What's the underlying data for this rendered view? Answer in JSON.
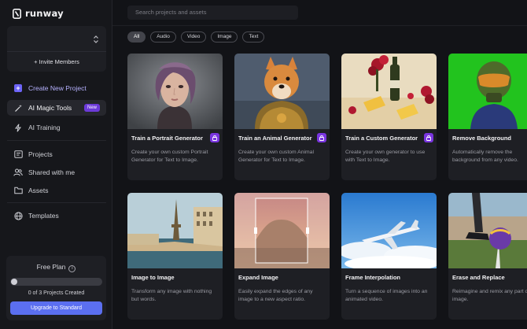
{
  "brand": {
    "name": "runway"
  },
  "workspace": {
    "invite_label": "+ Invite Members"
  },
  "nav": {
    "create_project": "Create New Project",
    "ai_magic_tools": "AI Magic Tools",
    "new_badge": "New",
    "ai_training": "AI Training",
    "projects": "Projects",
    "shared": "Shared with me",
    "assets": "Assets",
    "templates": "Templates"
  },
  "plan": {
    "title": "Free Plan",
    "info_icon": "i",
    "usage_text": "0 of 3 Projects Created",
    "usage_fraction": 0,
    "upgrade_label": "Upgrade to Standard"
  },
  "search": {
    "placeholder": "Search projects and assets"
  },
  "filters": [
    "All",
    "Audio",
    "Video",
    "Image",
    "Text"
  ],
  "active_filter": "All",
  "colors": {
    "accent": "#6c63f6",
    "badge_purple": "#7a35e0",
    "upgrade_blue": "#5b6ff0"
  },
  "cards": [
    {
      "title": "Train a Portrait Generator",
      "desc": "Create your own custom Portrait Generator for Text to Image.",
      "locked": true
    },
    {
      "title": "Train an Animal Generator",
      "desc": "Create your own custom Animal Generator for Text to Image.",
      "locked": true
    },
    {
      "title": "Train a Custom Generator",
      "desc": "Create your own generator to use with Text to Image.",
      "locked": true
    },
    {
      "title": "Remove Background",
      "desc": "Automatically remove the background from any video.",
      "locked": false
    },
    {
      "title": "Image to Image",
      "desc": "Transform any image with nothing but words.",
      "locked": false
    },
    {
      "title": "Expand Image",
      "desc": "Easily expand the edges of any image to a new aspect ratio.",
      "locked": false
    },
    {
      "title": "Frame Interpolation",
      "desc": "Turn a sequence of images into an animated video.",
      "locked": false
    },
    {
      "title": "Erase and Replace",
      "desc": "Reimagine and remix any part of any image.",
      "locked": false
    }
  ]
}
